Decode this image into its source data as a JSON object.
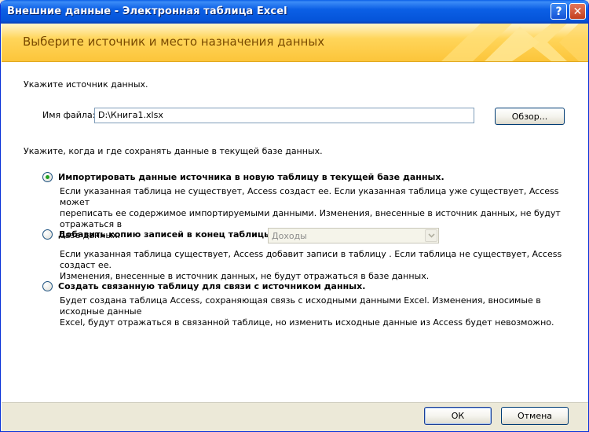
{
  "window": {
    "title": "Внешние данные - Электронная таблица Excel",
    "help_glyph": "?",
    "close_glyph": "✕"
  },
  "banner": {
    "title": "Выберите источник и место назначения данных"
  },
  "source": {
    "prompt": "Укажите источник данных.",
    "file_label": "Имя файла:",
    "file_value": "D:\\Книга1.xlsx",
    "browse_label": "Обзор..."
  },
  "storage": {
    "prompt": "Укажите, когда и где сохранять данные в текущей базе данных."
  },
  "options": {
    "import": {
      "label": "Импортировать данные источника в новую таблицу в текущей базе данных.",
      "selected": true,
      "desc1": "Если указанная таблица не существует, Access создаст ее. Если указанная таблица уже существует, Access может",
      "desc2": "переписать ее содержимое импортируемыми данными. Изменения, внесенные в источник данных, не будут отражаться в",
      "desc3": "базе данных."
    },
    "append": {
      "label": "Добавить копию записей в конец таблицы:",
      "selected": false,
      "combo_value": "Доходы",
      "desc1": "Если указанная таблица существует, Access добавит записи в таблицу . Если таблица не существует, Access создаст ее.",
      "desc2": "Изменения, внесенные в источник данных, не будут отражаться в базе данных."
    },
    "link": {
      "label": "Создать связанную таблицу для связи с источником данных.",
      "selected": false,
      "desc1": "Будет создана таблица Access, сохраняющая связь с исходными данными Excel. Изменения, вносимые в исходные данные",
      "desc2": "Excel, будут отражаться в связанной таблице, но изменить исходные данные из Access будет невозможно."
    }
  },
  "footer": {
    "ok_label": "ОК",
    "cancel_label": "Отмена"
  },
  "colors": {
    "titlebar": "#0554d9",
    "banner": "#fcc53a",
    "banner_text": "#7a4a00",
    "radio_selected": "#21a121"
  }
}
